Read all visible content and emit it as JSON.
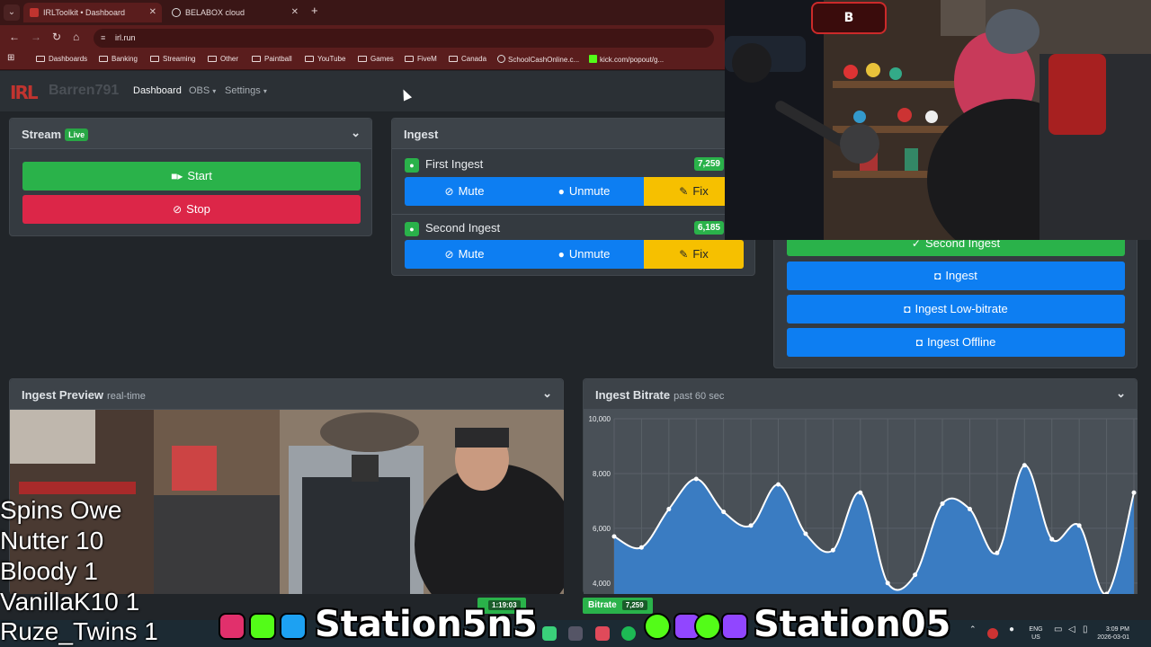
{
  "browser": {
    "tabs": [
      {
        "title": "IRLToolkit • Dashboard",
        "active": true
      },
      {
        "title": "BELABOX cloud",
        "active": false
      }
    ],
    "url": "irl.run",
    "bookmarks": [
      "Dashboards",
      "Banking",
      "Streaming",
      "Other",
      "Paintball",
      "YouTube",
      "Games",
      "FiveM",
      "Canada",
      "SchoolCashOnline.c...",
      "kick.com/popout/g..."
    ]
  },
  "nav": {
    "brand": "Barren791",
    "links": [
      {
        "label": "Dashboard"
      },
      {
        "label": "OBS"
      },
      {
        "label": "Settings"
      }
    ]
  },
  "stream": {
    "title": "Stream",
    "badge": "Live",
    "start_label": "Start",
    "stop_label": "Stop"
  },
  "ingest": {
    "title": "Ingest",
    "rows": [
      {
        "name": "First Ingest",
        "bitrate": "7,259"
      },
      {
        "name": "Second Ingest",
        "bitrate": "6,185"
      }
    ],
    "mute_label": "Mute",
    "unmute_label": "Unmute",
    "fix_label": "Fix"
  },
  "scenes": {
    "items": [
      "Second Ingest",
      "Ingest",
      "Ingest Low-bitrate",
      "Ingest Offline"
    ]
  },
  "preview": {
    "title": "Ingest Preview",
    "subtitle": "real-time"
  },
  "overlay": {
    "leaderboard": [
      "Spins Owe",
      "Nutter 10",
      "Bloody 1",
      "VanillaK10 1",
      "Ruze_Twins 1"
    ],
    "social_left": "Station5n5",
    "social_right": "Station05",
    "uptime_label": "",
    "uptime_value": "1:19:03",
    "bitrate_label": "Bitrate",
    "bitrate_value": "7,259"
  },
  "taskbar": {
    "lang": "ENG",
    "region": "US",
    "time": "3:09 PM",
    "date": "2026-03-01"
  },
  "colors": {
    "accent_green": "#2ab24a",
    "accent_red": "#dc2648",
    "accent_blue": "#0d7ef2",
    "accent_yellow": "#f6c000",
    "chart_fill": "#3a7cc2"
  },
  "chart_data": {
    "type": "area",
    "title": "Ingest Bitrate",
    "subtitle": "past 60 sec",
    "ylim": [
      3600,
      10000
    ],
    "yticks": [
      "10,000",
      "8,000",
      "6,000",
      "4,000"
    ],
    "ytick_values": [
      10000,
      8000,
      6000,
      4000
    ],
    "grid": true,
    "values": [
      5700,
      5300,
      6700,
      7800,
      6600,
      6100,
      7600,
      5800,
      5200,
      7300,
      4000,
      4300,
      6900,
      6700,
      5100,
      8300,
      5600,
      6100,
      3600,
      7300
    ]
  }
}
